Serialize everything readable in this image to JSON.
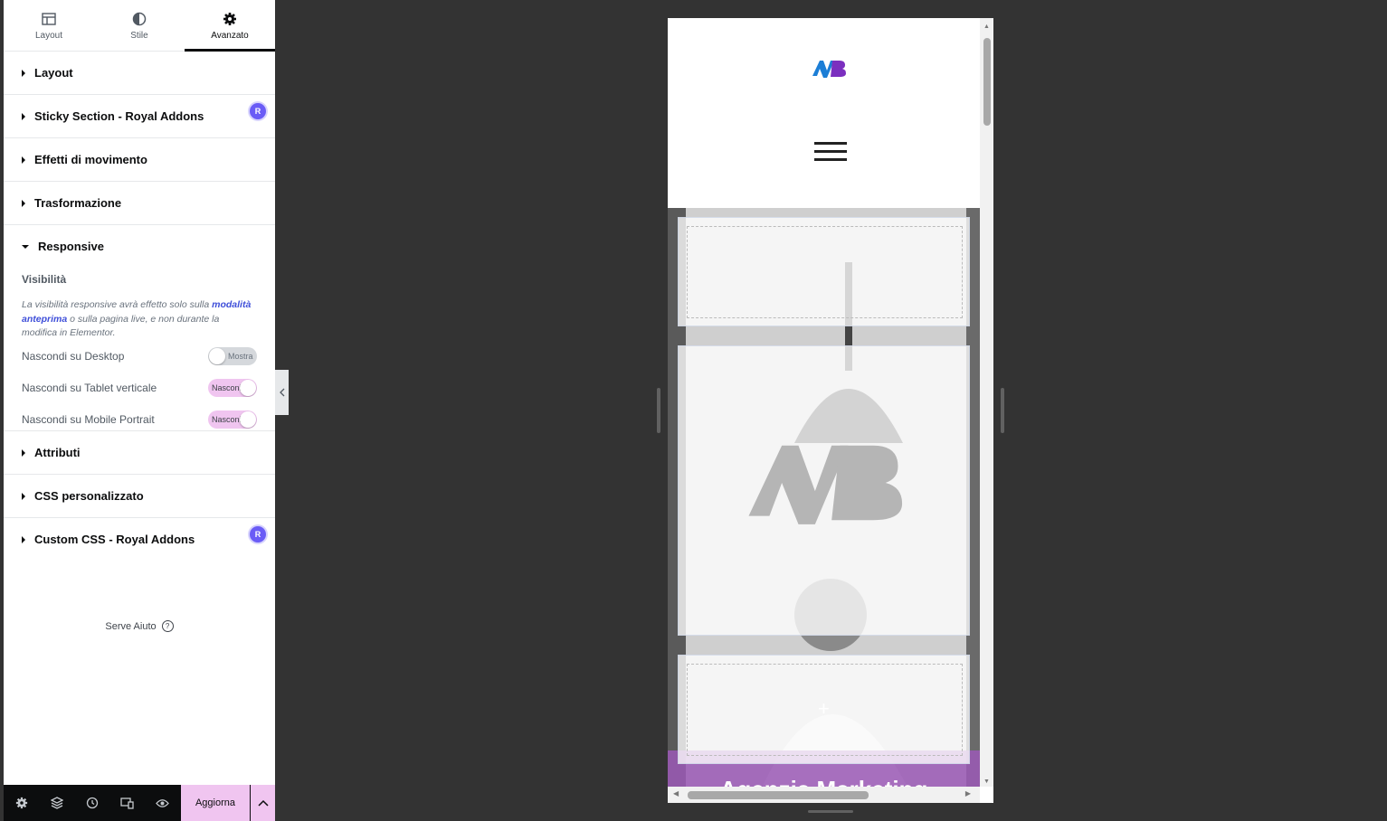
{
  "panel": {
    "tabs": [
      {
        "label": "Layout",
        "icon": "layout-icon"
      },
      {
        "label": "Stile",
        "icon": "contrast-icon"
      },
      {
        "label": "Avanzato",
        "icon": "gear-icon"
      }
    ],
    "sections": {
      "layout": "Layout",
      "sticky": "Sticky Section - Royal Addons",
      "effetti": "Effetti di movimento",
      "trasformazione": "Trasformazione",
      "responsive": "Responsive",
      "attributi": "Attributi",
      "css": "CSS personalizzato",
      "custom_css": "Custom CSS - Royal Addons"
    },
    "badge": "R",
    "responsive": {
      "title": "Visibilità",
      "desc_before": "La visibilità responsive avrà effetto solo sulla ",
      "desc_link": "modalità anteprima",
      "desc_after": " o sulla pagina live, e non durante la modifica in Elementor.",
      "rows": [
        {
          "label": "Nascondi su Desktop",
          "toggle": "Mostra",
          "on": false
        },
        {
          "label": "Nascondi su Tablet verticale",
          "toggle": "Nasconi",
          "on": true
        },
        {
          "label": "Nascondi su Mobile Portrait",
          "toggle": "Nasconi",
          "on": true
        }
      ]
    },
    "help": "Serve Aiuto",
    "footer": {
      "update": "Aggiorna"
    }
  },
  "preview": {
    "banner_text": "Agenzia Marketing",
    "colors": {
      "accent": "#f0c5f0",
      "logo_blue": "#1c7ed6",
      "logo_purple": "#7b2fbf",
      "banner": "#9b59b6"
    }
  }
}
